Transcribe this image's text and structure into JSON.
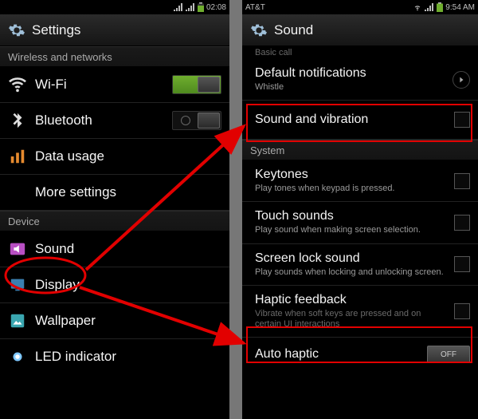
{
  "left": {
    "status": {
      "carrier": "",
      "time": "02:08"
    },
    "header": {
      "title": "Settings"
    },
    "sections": {
      "wireless_label": "Wireless and networks",
      "device_label": "Device"
    },
    "rows": {
      "wifi": {
        "label": "Wi-Fi"
      },
      "bluetooth": {
        "label": "Bluetooth"
      },
      "data_usage": {
        "label": "Data usage"
      },
      "more_settings": {
        "label": "More settings"
      },
      "sound": {
        "label": "Sound"
      },
      "display": {
        "label": "Display"
      },
      "wallpaper": {
        "label": "Wallpaper"
      },
      "led": {
        "label": "LED indicator"
      }
    }
  },
  "right": {
    "status": {
      "carrier": "AT&T",
      "time": "9:54 AM"
    },
    "header": {
      "title": "Sound"
    },
    "truncated_top": "Basic call",
    "rows": {
      "default_notifications": {
        "label": "Default notifications",
        "sub": "Whistle"
      },
      "sound_vibration": {
        "label": "Sound and vibration"
      },
      "system_label": "System",
      "keytones": {
        "label": "Keytones",
        "sub": "Play tones when keypad is pressed."
      },
      "touch_sounds": {
        "label": "Touch sounds",
        "sub": "Play sound when making screen selection."
      },
      "screen_lock": {
        "label": "Screen lock sound",
        "sub": "Play sounds when locking and unlocking screen."
      },
      "haptic": {
        "label": "Haptic feedback",
        "sub": "Vibrate when soft keys are pressed and on certain UI interactions"
      },
      "auto_haptic": {
        "label": "Auto haptic",
        "pill": "OFF"
      }
    }
  }
}
